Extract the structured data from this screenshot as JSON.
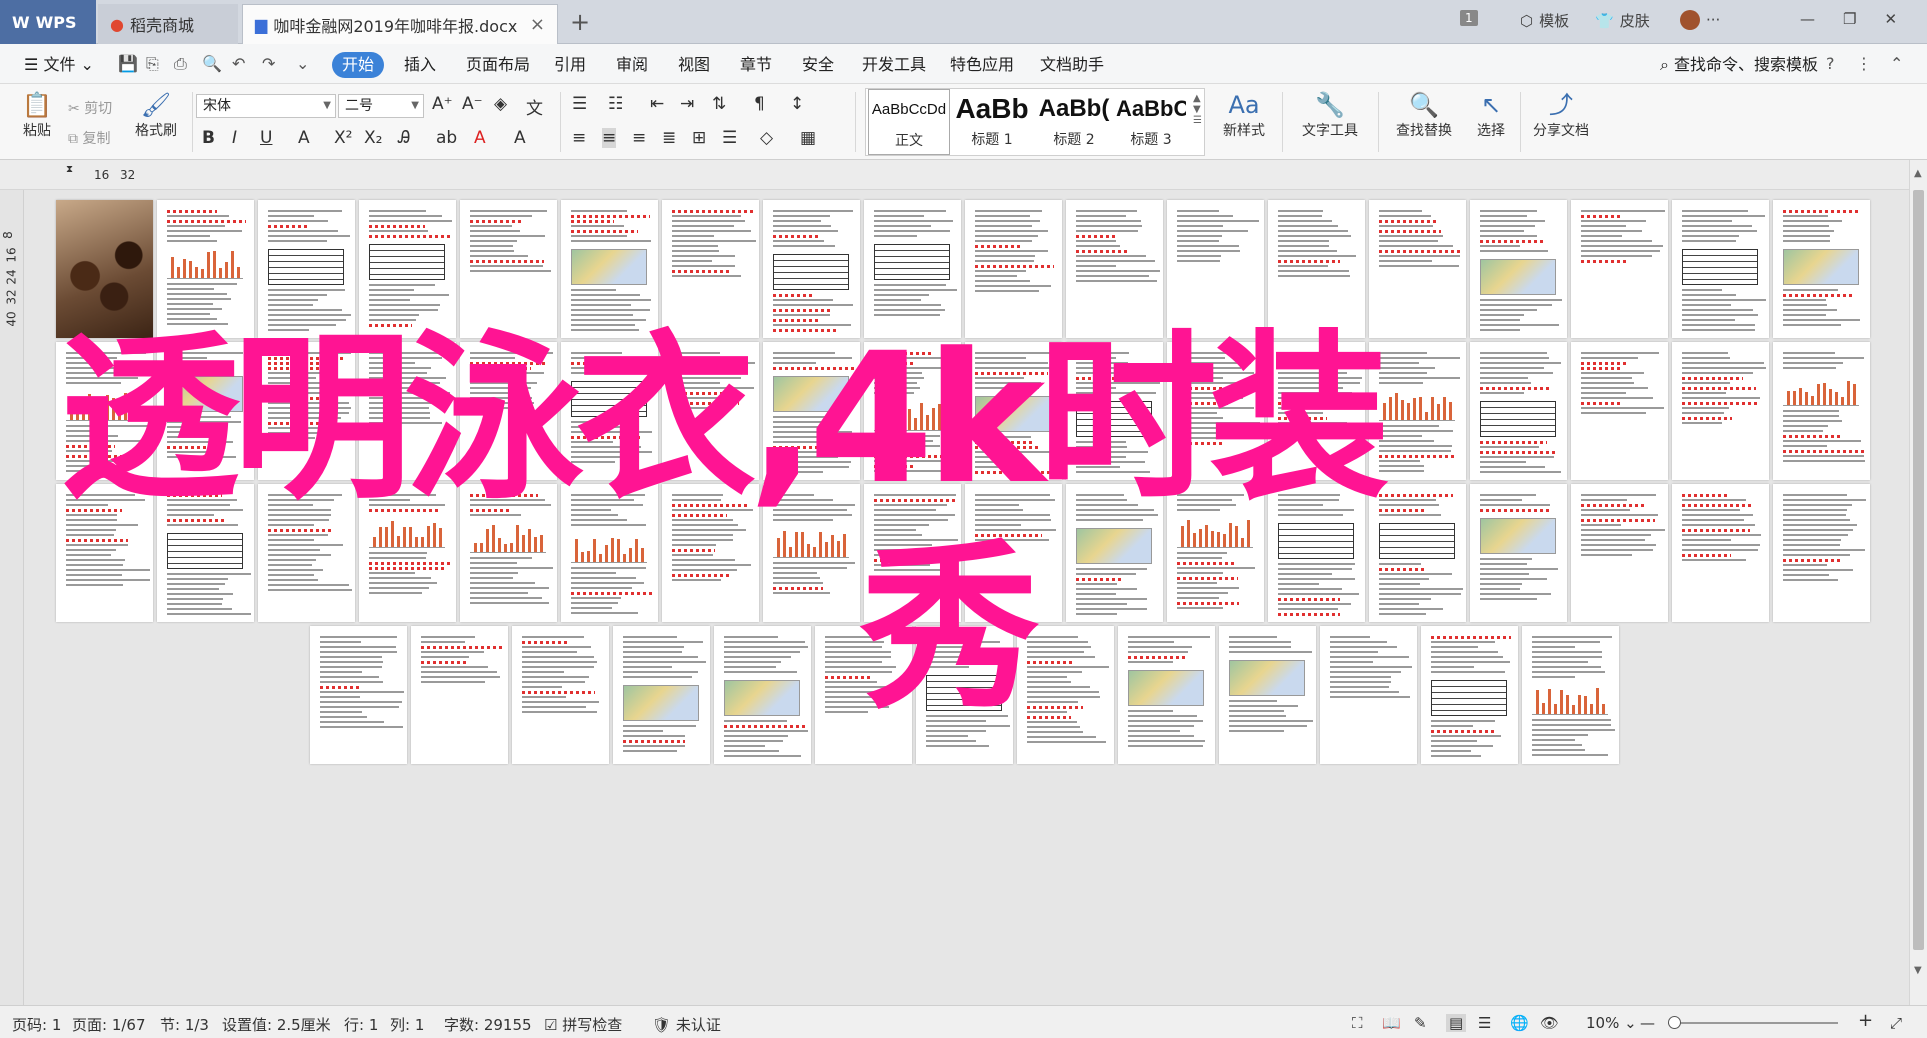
{
  "tabs": {
    "wps": "WPS",
    "shell": "稻壳商城",
    "doc": "咖啡金融网2019年咖啡年报.docx",
    "add": "+",
    "close": "×"
  },
  "titlebar_right": {
    "count": "1",
    "template": "模板",
    "skin": "皮肤"
  },
  "menu": {
    "file": "文件",
    "items": [
      "开始",
      "插入",
      "页面布局",
      "引用",
      "审阅",
      "视图",
      "章节",
      "安全",
      "开发工具",
      "特色应用",
      "文档助手"
    ],
    "search": "查找命令、搜索模板"
  },
  "ribbon": {
    "paste": "粘贴",
    "cut": "剪切",
    "copy": "复制",
    "format_painter": "格式刷",
    "font_name": "宋体",
    "font_size": "二号",
    "styles": [
      {
        "preview": "AaBbCcDd",
        "label": "正文"
      },
      {
        "preview": "AaBb",
        "label": "标题 1"
      },
      {
        "preview": "AaBb(",
        "label": "标题 2"
      },
      {
        "preview": "AaBbC",
        "label": "标题 3"
      }
    ],
    "new_style": "新样式",
    "text_tools": "文字工具",
    "find_replace": "查找替换",
    "select": "选择",
    "share": "分享文档"
  },
  "ruler": {
    "marks": [
      "16",
      "32"
    ]
  },
  "vruler": {
    "marks": [
      "8",
      "16",
      "24",
      "32",
      "40"
    ]
  },
  "overlay": {
    "line1": "透明泳衣,4k时装",
    "line2": "秀"
  },
  "status": {
    "page_num": "页码: 1",
    "pages": "页面: 1/67",
    "section": "节: 1/3",
    "setting": "设置值: 2.5厘米",
    "row": "行: 1",
    "col": "列: 1",
    "words": "字数: 29155",
    "spell": "拼写检查",
    "cert": "未认证",
    "zoom": "10%"
  }
}
